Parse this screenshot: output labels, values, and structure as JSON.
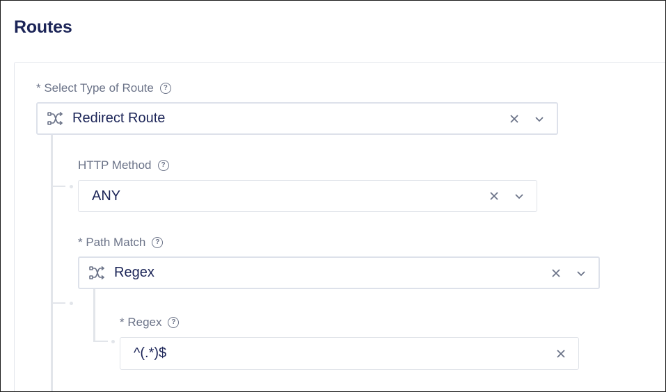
{
  "page": {
    "title": "Routes"
  },
  "route_type": {
    "label": "* Select Type of Route",
    "value": "Redirect Route",
    "icon": "route-split-icon"
  },
  "http_method": {
    "label": "HTTP Method",
    "value": "ANY"
  },
  "path_match": {
    "label": "* Path Match",
    "value": "Regex",
    "icon": "route-split-icon"
  },
  "regex": {
    "label": "* Regex",
    "value": "^(.*)$"
  },
  "colors": {
    "title": "#1b2457",
    "label": "#6b7388",
    "border": "#dfe2e8",
    "tree_line": "#e2e5ea"
  }
}
